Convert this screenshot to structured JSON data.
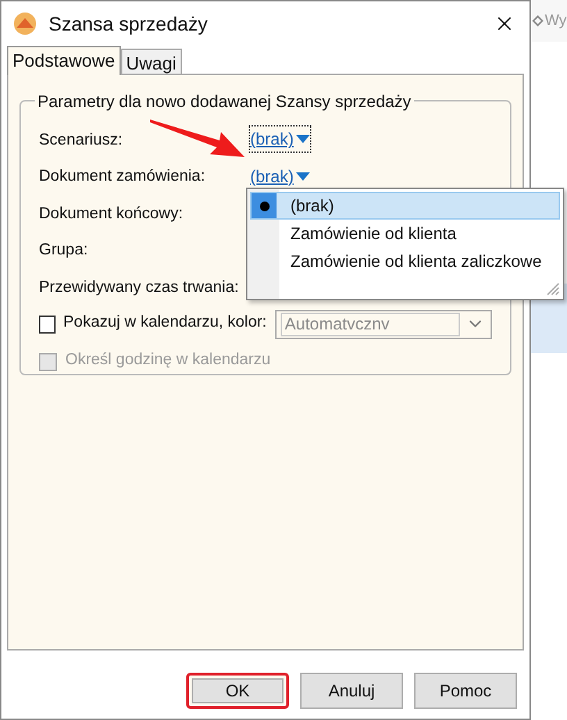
{
  "window": {
    "title": "Szansa sprzedaży"
  },
  "tabs": [
    {
      "label": "Podstawowe",
      "selected": true
    },
    {
      "label": "Uwagi",
      "selected": false
    }
  ],
  "group": {
    "title": "Parametry dla nowo dodawanej Szansy sprzedaży",
    "fields": [
      {
        "label": "Scenariusz:",
        "value": "(brak)",
        "focused": true
      },
      {
        "label": "Dokument zamówienia:",
        "value": "(brak)",
        "focused": false
      },
      {
        "label": "Dokument końcowy:"
      },
      {
        "label": "Grupa:"
      },
      {
        "label": "Przewidywany czas trwania:"
      }
    ],
    "checkboxes": [
      {
        "label": "Pokazuj w kalendarzu, kolor:",
        "checked": false,
        "disabled": false,
        "color_select": {
          "value": "Automatvcznv",
          "disabled": true
        }
      },
      {
        "label": "Określ godzinę w kalendarzu",
        "checked": false,
        "disabled": true
      }
    ]
  },
  "dropdown": {
    "options": [
      {
        "label": "(brak)",
        "selected": true
      },
      {
        "label": "Zamówienie od klienta",
        "selected": false
      },
      {
        "label": "Zamówienie od klienta zaliczkowe",
        "selected": false
      }
    ]
  },
  "buttons": [
    {
      "label": "OK",
      "highlighted": true
    },
    {
      "label": "Anuluj",
      "highlighted": false
    },
    {
      "label": "Pomoc",
      "highlighted": false
    }
  ],
  "background": {
    "toolbar_text": "Wy"
  }
}
